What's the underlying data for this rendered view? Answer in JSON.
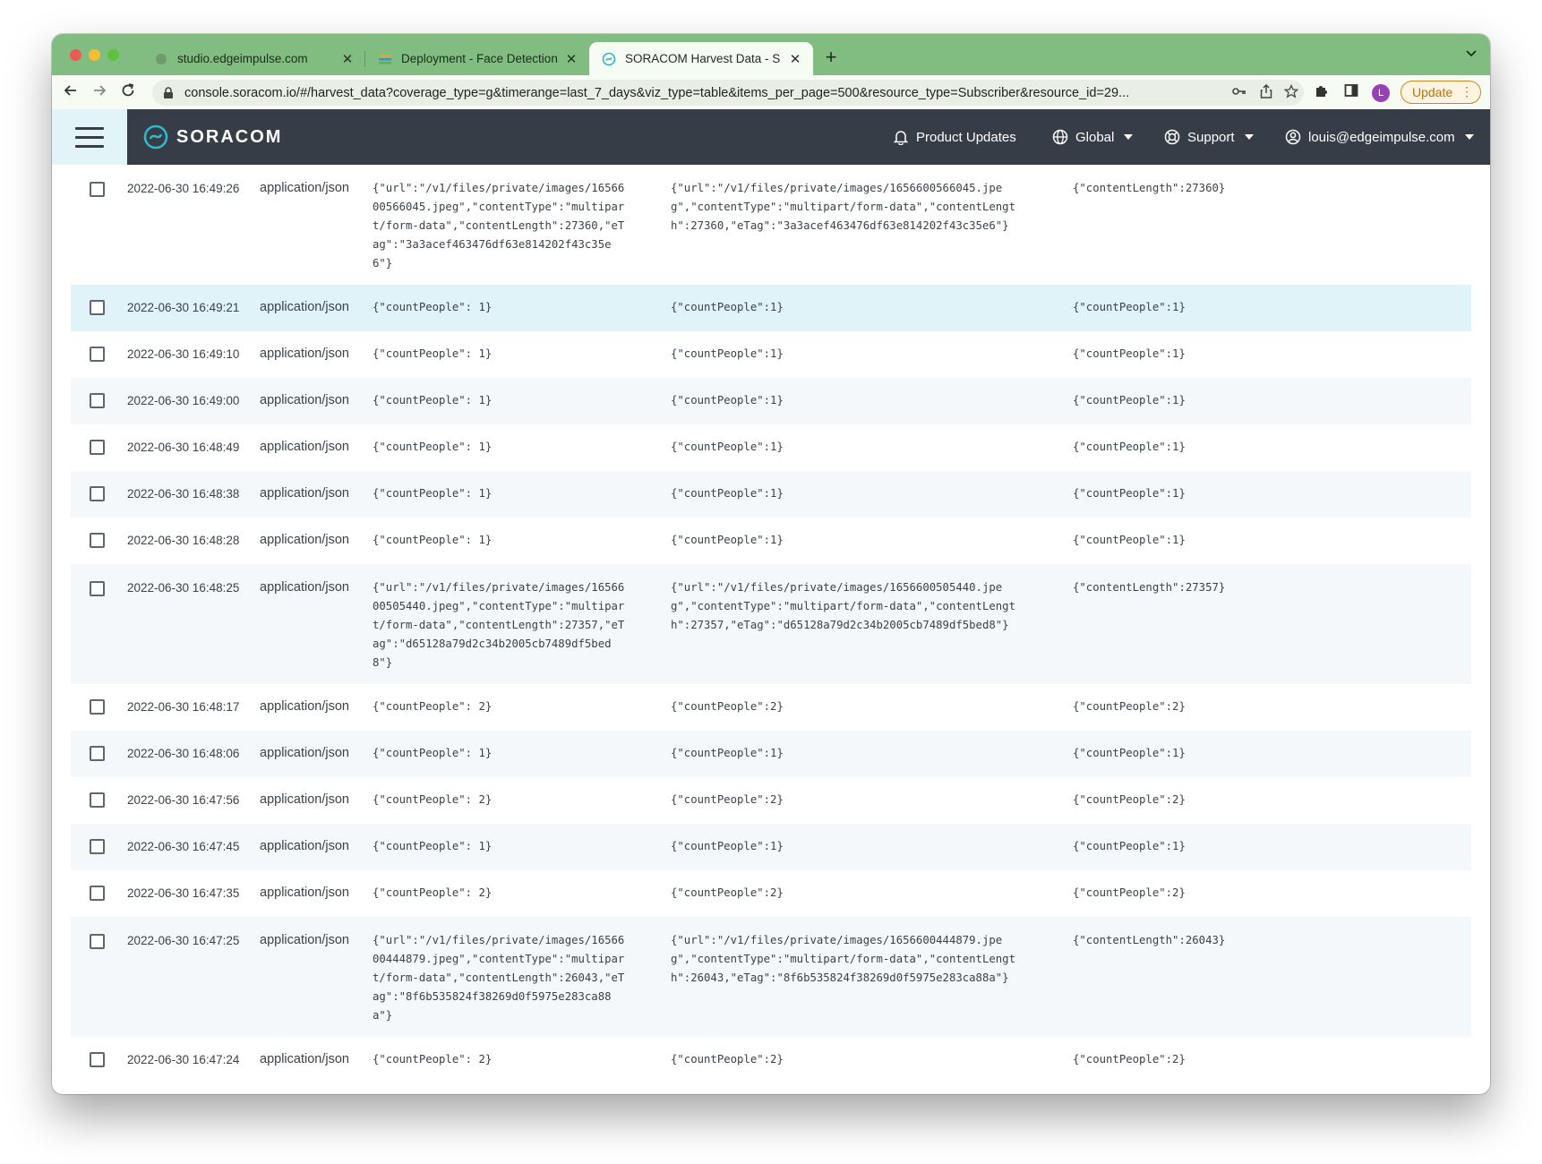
{
  "browser": {
    "tabs": [
      {
        "title": "studio.edgeimpulse.com",
        "active": false,
        "favicon": "edgeimpulse-icon"
      },
      {
        "title": "Deployment - Face Detection -",
        "active": false,
        "favicon": "edgeimpulse-colored-icon"
      },
      {
        "title": "SORACOM Harvest Data - SOR",
        "active": true,
        "favicon": "soracom-icon"
      }
    ],
    "close_glyph": "✕",
    "new_tab_glyph": "+",
    "url": "console.soracom.io/#/harvest_data?coverage_type=g&timerange=last_7_days&viz_type=table&items_per_page=500&resource_type=Subscriber&resource_id=29...",
    "profile_initial": "L",
    "update_label": "Update"
  },
  "app": {
    "brand": "SORACOM",
    "nav": {
      "product_updates": "Product Updates",
      "region": "Global",
      "support": "Support",
      "user": "louis@edgeimpulse.com"
    }
  },
  "table": {
    "rows": [
      {
        "time": "2022-06-30 16:49:26",
        "type": "application/json",
        "raw": "{\"url\":\"/v1/files/private/images/16566\n00566045.jpeg\",\"contentType\":\"multipar\nt/form-data\",\"contentLength\":27360,\"eT\nag\":\"3a3acef463476df63e814202f43c35e\n6\"}",
        "parsed": "{\"url\":\"/v1/files/private/images/1656600566045.jpe\ng\",\"contentType\":\"multipart/form-data\",\"contentLengt\nh\":27360,\"eTag\":\"3a3acef463476df63e814202f43c35e6\"}",
        "meta": "{\"contentLength\":27360}"
      },
      {
        "time": "2022-06-30 16:49:21",
        "type": "application/json",
        "raw": "{\"countPeople\": 1}",
        "parsed": "{\"countPeople\":1}",
        "meta": "{\"countPeople\":1}"
      },
      {
        "time": "2022-06-30 16:49:10",
        "type": "application/json",
        "raw": "{\"countPeople\": 1}",
        "parsed": "{\"countPeople\":1}",
        "meta": "{\"countPeople\":1}"
      },
      {
        "time": "2022-06-30 16:49:00",
        "type": "application/json",
        "raw": "{\"countPeople\": 1}",
        "parsed": "{\"countPeople\":1}",
        "meta": "{\"countPeople\":1}"
      },
      {
        "time": "2022-06-30 16:48:49",
        "type": "application/json",
        "raw": "{\"countPeople\": 1}",
        "parsed": "{\"countPeople\":1}",
        "meta": "{\"countPeople\":1}"
      },
      {
        "time": "2022-06-30 16:48:38",
        "type": "application/json",
        "raw": "{\"countPeople\": 1}",
        "parsed": "{\"countPeople\":1}",
        "meta": "{\"countPeople\":1}"
      },
      {
        "time": "2022-06-30 16:48:28",
        "type": "application/json",
        "raw": "{\"countPeople\": 1}",
        "parsed": "{\"countPeople\":1}",
        "meta": "{\"countPeople\":1}"
      },
      {
        "time": "2022-06-30 16:48:25",
        "type": "application/json",
        "raw": "{\"url\":\"/v1/files/private/images/16566\n00505440.jpeg\",\"contentType\":\"multipar\nt/form-data\",\"contentLength\":27357,\"eT\nag\":\"d65128a79d2c34b2005cb7489df5bed\n8\"}",
        "parsed": "{\"url\":\"/v1/files/private/images/1656600505440.jpe\ng\",\"contentType\":\"multipart/form-data\",\"contentLengt\nh\":27357,\"eTag\":\"d65128a79d2c34b2005cb7489df5bed8\"}",
        "meta": "{\"contentLength\":27357}"
      },
      {
        "time": "2022-06-30 16:48:17",
        "type": "application/json",
        "raw": "{\"countPeople\": 2}",
        "parsed": "{\"countPeople\":2}",
        "meta": "{\"countPeople\":2}"
      },
      {
        "time": "2022-06-30 16:48:06",
        "type": "application/json",
        "raw": "{\"countPeople\": 1}",
        "parsed": "{\"countPeople\":1}",
        "meta": "{\"countPeople\":1}"
      },
      {
        "time": "2022-06-30 16:47:56",
        "type": "application/json",
        "raw": "{\"countPeople\": 2}",
        "parsed": "{\"countPeople\":2}",
        "meta": "{\"countPeople\":2}"
      },
      {
        "time": "2022-06-30 16:47:45",
        "type": "application/json",
        "raw": "{\"countPeople\": 1}",
        "parsed": "{\"countPeople\":1}",
        "meta": "{\"countPeople\":1}"
      },
      {
        "time": "2022-06-30 16:47:35",
        "type": "application/json",
        "raw": "{\"countPeople\": 2}",
        "parsed": "{\"countPeople\":2}",
        "meta": "{\"countPeople\":2}"
      },
      {
        "time": "2022-06-30 16:47:25",
        "type": "application/json",
        "raw": "{\"url\":\"/v1/files/private/images/16566\n00444879.jpeg\",\"contentType\":\"multipar\nt/form-data\",\"contentLength\":26043,\"eT\nag\":\"8f6b535824f38269d0f5975e283ca88\na\"}",
        "parsed": "{\"url\":\"/v1/files/private/images/1656600444879.jpe\ng\",\"contentType\":\"multipart/form-data\",\"contentLengt\nh\":26043,\"eTag\":\"8f6b535824f38269d0f5975e283ca88a\"}",
        "meta": "{\"contentLength\":26043}"
      },
      {
        "time": "2022-06-30 16:47:24",
        "type": "application/json",
        "raw": "{\"countPeople\": 2}",
        "parsed": "{\"countPeople\":2}",
        "meta": "{\"countPeople\":2}"
      }
    ]
  }
}
